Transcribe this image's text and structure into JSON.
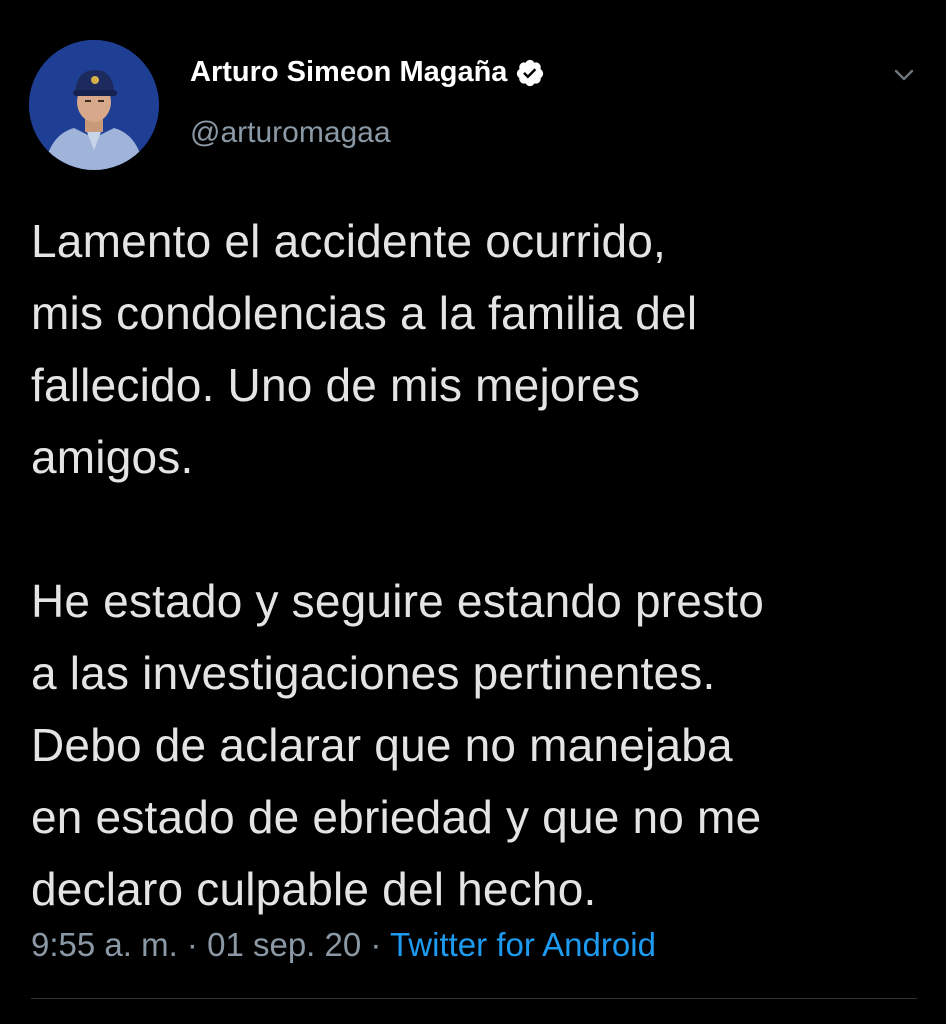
{
  "user": {
    "display_name": "Arturo Simeon Magaña",
    "handle": "@arturomagaa",
    "verified": true,
    "avatar_icon": "profile-photo"
  },
  "menu": {
    "icon": "chevron-down-icon"
  },
  "tweet": {
    "text": "Lamento el accidente ocurrido,\nmis condolencias a la familia del\nfallecido. Uno de mis mejores\namigos.\n\nHe estado y seguire estando presto\na las investigaciones pertinentes.\nDebo de aclarar que no manejaba\nen estado de ebriedad y que no me\ndeclaro culpable del hecho."
  },
  "meta": {
    "time": "9:55 a. m.",
    "separator": "·",
    "date": "01 sep. 20",
    "source": "Twitter for Android"
  },
  "colors": {
    "background": "#000000",
    "link": "#1d9bf0",
    "secondary_text": "#8b98a5",
    "primary_text": "#e4e4e4"
  }
}
